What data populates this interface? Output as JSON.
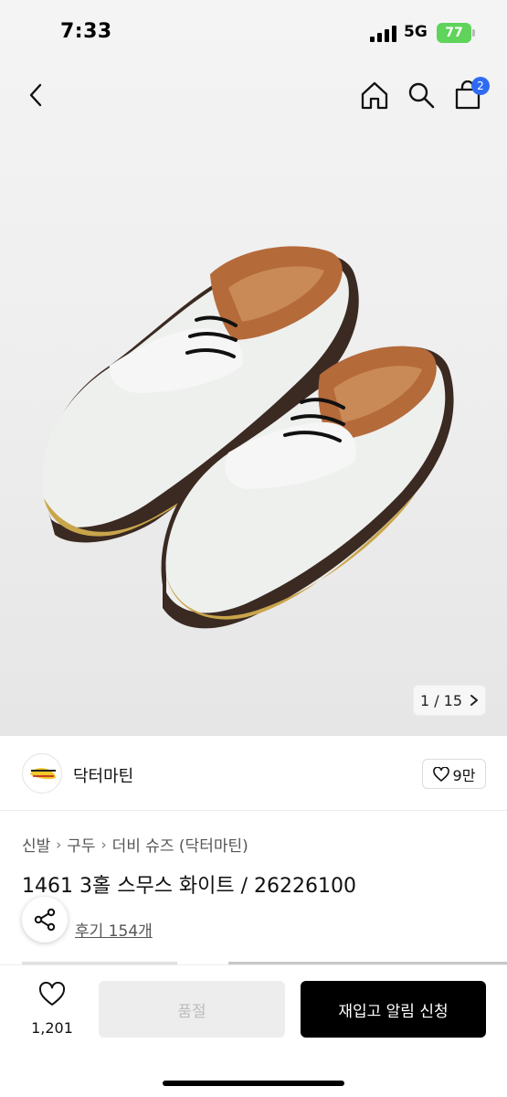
{
  "status_bar": {
    "time": "7:33",
    "network": "5G",
    "battery": "77"
  },
  "nav": {
    "back_icon": "chevron-left-icon",
    "home_icon": "home-icon",
    "search_icon": "search-icon",
    "cart_icon": "shopping-bag-icon",
    "cart_count": "2"
  },
  "gallery": {
    "indicator": "1 / 15"
  },
  "brand": {
    "name": "닥터마틴",
    "likes": "9만"
  },
  "breadcrumb": [
    "신발",
    "구두",
    "더비 슈즈 (닥터마틴)"
  ],
  "product": {
    "title": "1461 3홀 스무스 화이트 / 26226100",
    "reviews": "후기 154개"
  },
  "bottom_bar": {
    "wish_count": "1,201",
    "soldout_label": "품절",
    "restock_label": "재입고 알림 신청"
  },
  "colors": {
    "accent_blue": "#2f6bf2",
    "battery_green": "#5fd35a",
    "primary_button": "#000000"
  }
}
